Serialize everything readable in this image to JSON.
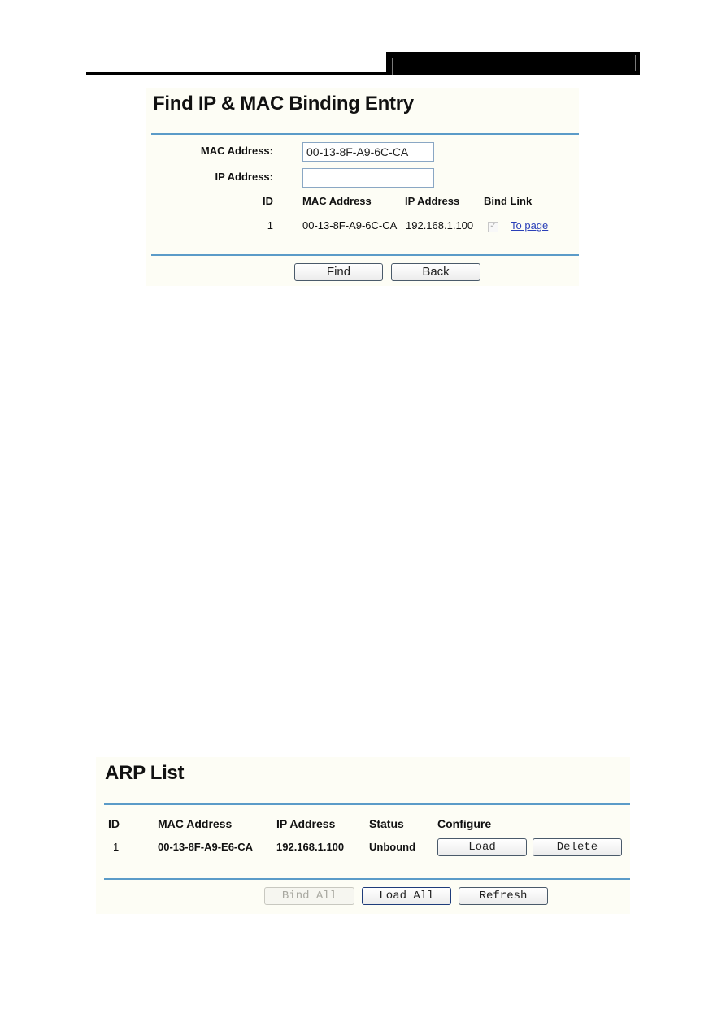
{
  "find_panel": {
    "title": "Find IP & MAC Binding Entry",
    "mac_label": "MAC Address:",
    "ip_label": "IP Address:",
    "mac_value": "00-13-8F-A9-6C-CA",
    "ip_value": "",
    "table": {
      "headers": [
        "ID",
        "MAC Address",
        "IP Address",
        "Bind Link"
      ],
      "rows": [
        {
          "id": "1",
          "mac": "00-13-8F-A9-6C-CA",
          "ip": "192.168.1.100",
          "bound": true,
          "link": "To page"
        }
      ]
    },
    "buttons": {
      "find": "Find",
      "back": "Back"
    }
  },
  "arp_panel": {
    "title": "ARP List",
    "table": {
      "headers": [
        "ID",
        "MAC Address",
        "IP Address",
        "Status",
        "Configure"
      ],
      "rows": [
        {
          "id": "1",
          "mac": "00-13-8F-A9-E6-CA",
          "ip": "192.168.1.100",
          "status": "Unbound",
          "load": "Load",
          "delete": "Delete"
        }
      ]
    },
    "buttons": {
      "bind_all": "Bind All",
      "load_all": "Load All",
      "refresh": "Refresh"
    }
  },
  "colors": {
    "rule": "#5b9bc8",
    "panel_bg": "#fdfdf5",
    "link": "#2a3fb8"
  }
}
